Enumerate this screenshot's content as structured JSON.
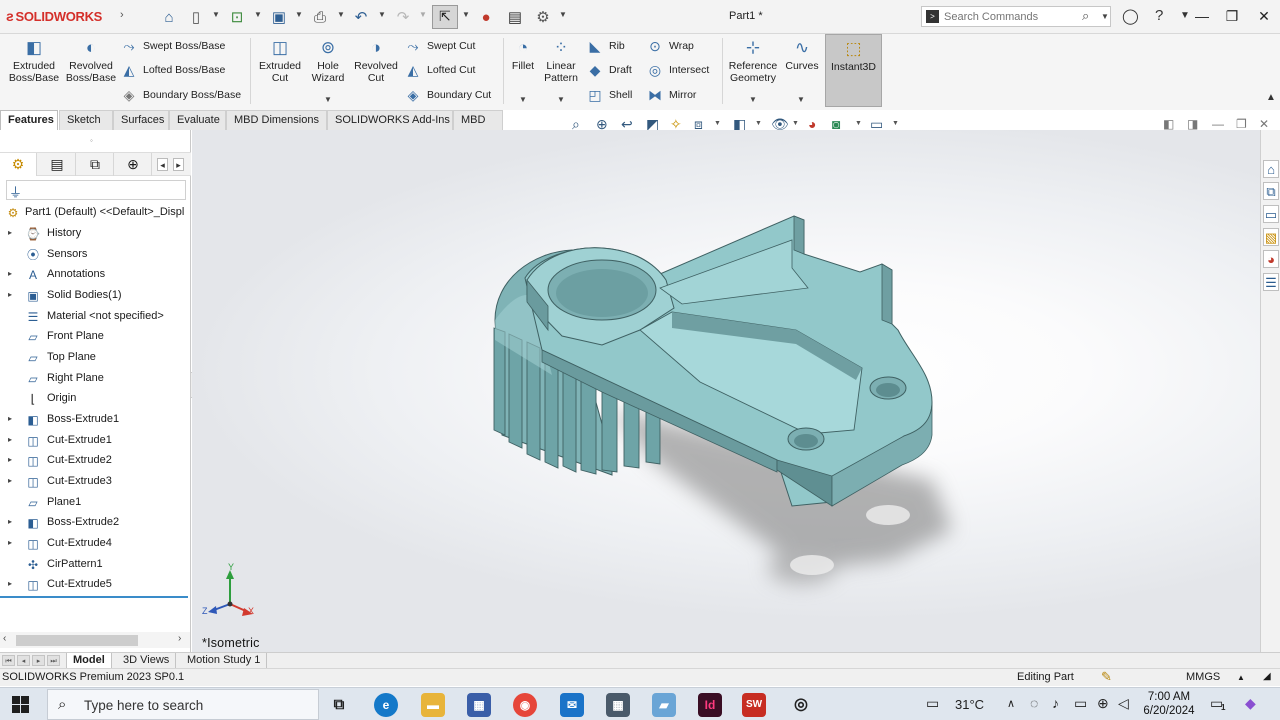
{
  "titlebar": {
    "app_name": "SOLIDWORKS",
    "document_title": "Part1 *",
    "search_placeholder": "Search Commands"
  },
  "command_manager": {
    "extruded_boss_base": "Extruded\nBoss/Base",
    "revolved_boss_base": "Revolved\nBoss/Base",
    "swept_boss_base": "Swept Boss/Base",
    "lofted_boss_base": "Lofted Boss/Base",
    "boundary_boss_base": "Boundary Boss/Base",
    "extruded_cut": "Extruded\nCut",
    "hole_wizard": "Hole\nWizard",
    "revolved_cut": "Revolved\nCut",
    "swept_cut": "Swept Cut",
    "lofted_cut": "Lofted Cut",
    "boundary_cut": "Boundary Cut",
    "fillet": "Fillet",
    "linear_pattern": "Linear\nPattern",
    "rib": "Rib",
    "draft": "Draft",
    "shell": "Shell",
    "wrap": "Wrap",
    "intersect": "Intersect",
    "mirror": "Mirror",
    "reference_geometry": "Reference\nGeometry",
    "curves": "Curves",
    "instant3d": "Instant3D"
  },
  "tabs": [
    "Features",
    "Sketch",
    "Surfaces",
    "Evaluate",
    "MBD Dimensions",
    "SOLIDWORKS Add-Ins",
    "MBD"
  ],
  "tree": {
    "root": "Part1 (Default) <<Default>_Displ",
    "items": [
      {
        "label": "History",
        "icon": "history-icon",
        "expandable": true
      },
      {
        "label": "Sensors",
        "icon": "sensor-icon",
        "expandable": false
      },
      {
        "label": "Annotations",
        "icon": "annotation-icon",
        "expandable": true
      },
      {
        "label": "Solid Bodies(1)",
        "icon": "solid-bodies-icon",
        "expandable": true
      },
      {
        "label": "Material <not specified>",
        "icon": "material-icon",
        "expandable": false
      },
      {
        "label": "Front Plane",
        "icon": "plane-icon",
        "expandable": false
      },
      {
        "label": "Top Plane",
        "icon": "plane-icon",
        "expandable": false
      },
      {
        "label": "Right Plane",
        "icon": "plane-icon",
        "expandable": false
      },
      {
        "label": "Origin",
        "icon": "origin-icon",
        "expandable": false
      },
      {
        "label": "Boss-Extrude1",
        "icon": "extrude-feature-icon",
        "expandable": true
      },
      {
        "label": "Cut-Extrude1",
        "icon": "cut-feature-icon",
        "expandable": true
      },
      {
        "label": "Cut-Extrude2",
        "icon": "cut-feature-icon",
        "expandable": true
      },
      {
        "label": "Cut-Extrude3",
        "icon": "cut-feature-icon",
        "expandable": true
      },
      {
        "label": "Plane1",
        "icon": "plane-icon",
        "expandable": false
      },
      {
        "label": "Boss-Extrude2",
        "icon": "extrude-feature-icon",
        "expandable": true
      },
      {
        "label": "Cut-Extrude4",
        "icon": "cut-feature-icon",
        "expandable": true
      },
      {
        "label": "CirPattern1",
        "icon": "circular-pattern-icon",
        "expandable": false
      },
      {
        "label": "Cut-Extrude5",
        "icon": "cut-feature-icon",
        "expandable": true
      }
    ]
  },
  "viewport": {
    "view_orientation": "*Isometric",
    "triad": {
      "x": "X",
      "y": "Y",
      "z": "Z"
    },
    "part_color": "#8fc6c8"
  },
  "bottom_tabs": [
    "Model",
    "3D Views",
    "Motion Study 1"
  ],
  "status": {
    "product": "SOLIDWORKS Premium 2023 SP0.1",
    "mode": "Editing Part",
    "units": "MMGS"
  },
  "taskbar": {
    "search_placeholder": "Type here to search",
    "temperature": "31°C",
    "time": "7:00 AM",
    "date": "6/20/2024",
    "notification_count": "1"
  }
}
